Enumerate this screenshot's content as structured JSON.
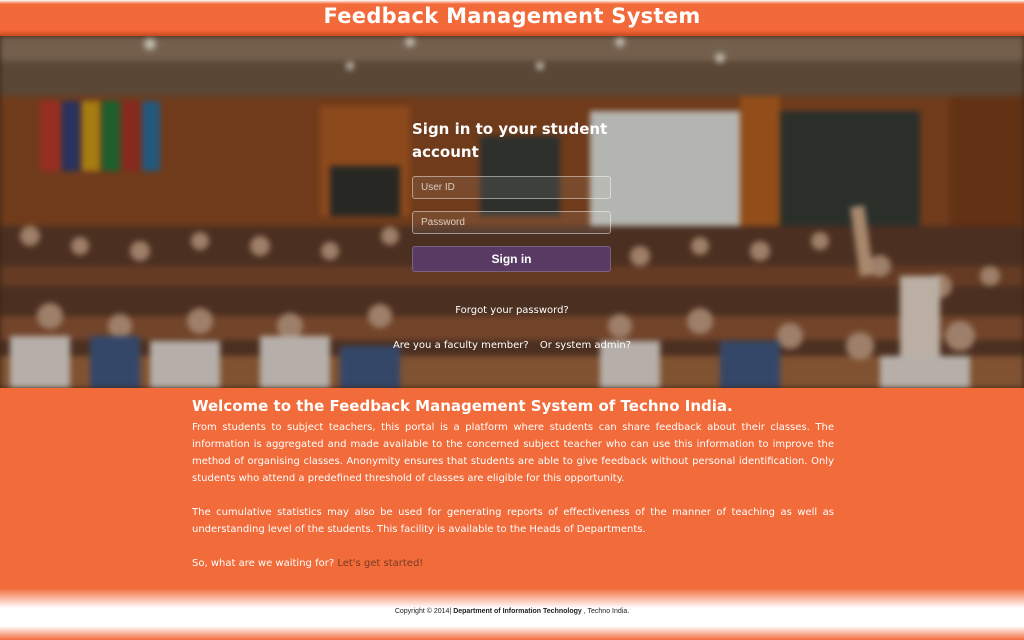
{
  "header": {
    "title": "Feedback Management System"
  },
  "login": {
    "title": "Sign in to your student account",
    "userid_placeholder": "User ID",
    "password_placeholder": "Password",
    "signin_label": "Sign in",
    "forgot_label": "Forgot your password?",
    "faculty_label": "Are you a faculty member?",
    "admin_label": "Or system admin?"
  },
  "content": {
    "welcome": "Welcome to the Feedback Management System of Techno India.",
    "para1": "From students to subject teachers, this portal is a platform where students can share feedback about their classes. The information is aggregated and made available to the concerned subject teacher who can use this information to improve the method of organising classes. Anonymity ensures that students are able to give feedback without personal identification. Only students who attend a predefined threshold of classes are eligible for this opportunity.",
    "para2": "The cumulative statistics may also be used for generating reports of effectiveness of the manner of teaching as well as understanding level of the students. This facility is available to the Heads of Departments.",
    "para3_prefix": "So, what are we waiting for? ",
    "para3_link": "Let's get started!"
  },
  "footer": {
    "copyright": "Copyright © 2014|",
    "department": "Department of Information Technology",
    "suffix": ", Techno India."
  },
  "colors": {
    "accent": "#f26b3a",
    "button": "#5a3c6e"
  }
}
